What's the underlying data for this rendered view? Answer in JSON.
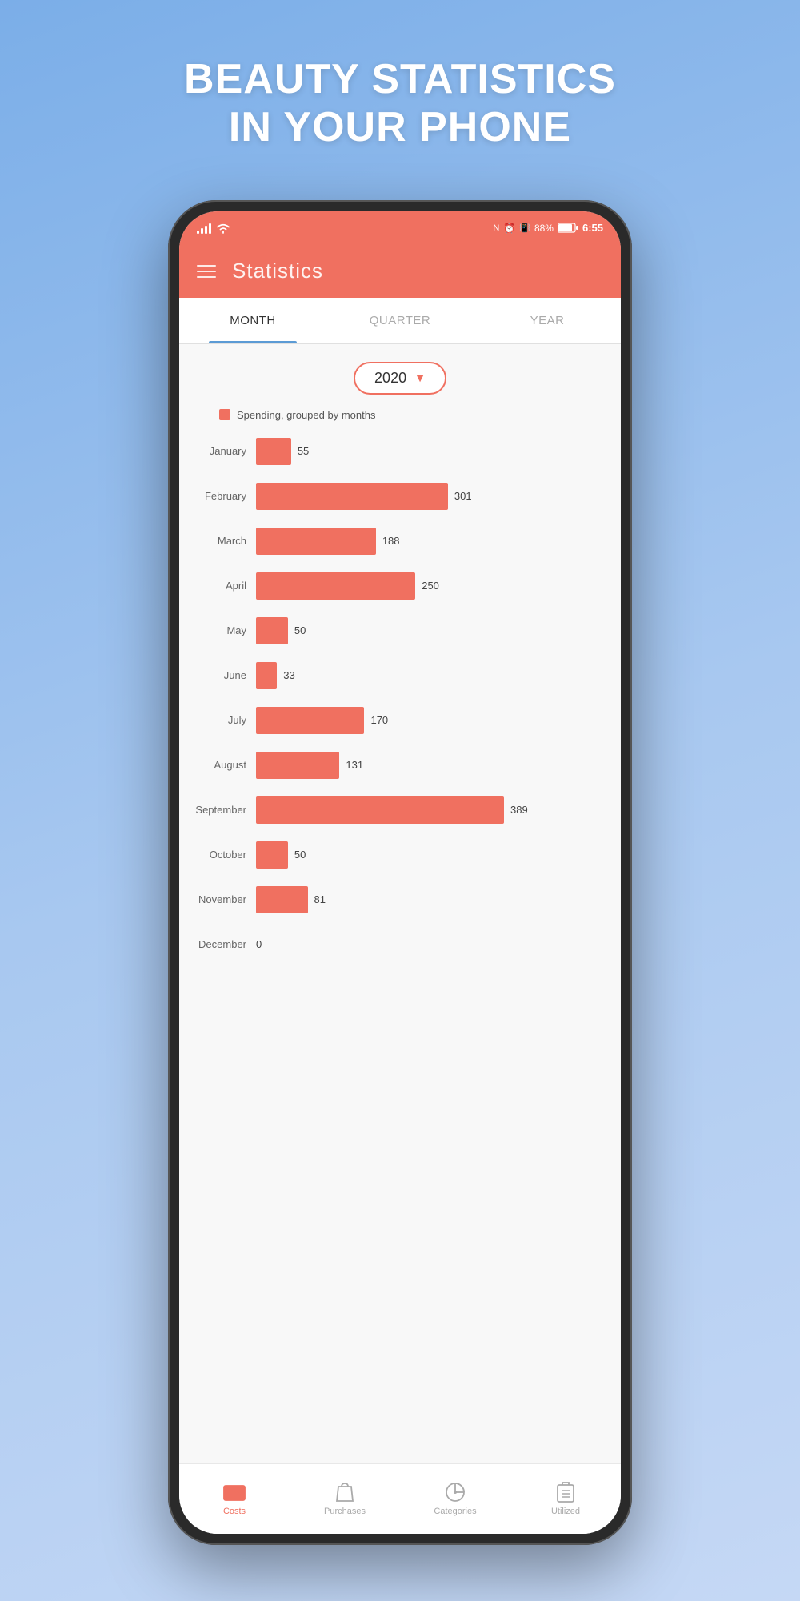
{
  "hero": {
    "line1": "BEAUTY STATISTICS",
    "line2": "IN YOUR PHONE"
  },
  "statusBar": {
    "battery": "88%",
    "time": "6:55"
  },
  "header": {
    "title": "Statistics"
  },
  "tabs": [
    {
      "label": "MONTH",
      "active": true
    },
    {
      "label": "QUARTER",
      "active": false
    },
    {
      "label": "YEAR",
      "active": false
    }
  ],
  "yearSelector": {
    "year": "2020"
  },
  "chart": {
    "legend": "Spending, grouped by months",
    "maxValue": 389,
    "rows": [
      {
        "month": "January",
        "value": 55
      },
      {
        "month": "February",
        "value": 301
      },
      {
        "month": "March",
        "value": 188
      },
      {
        "month": "April",
        "value": 250
      },
      {
        "month": "May",
        "value": 50
      },
      {
        "month": "June",
        "value": 33
      },
      {
        "month": "July",
        "value": 170
      },
      {
        "month": "August",
        "value": 131
      },
      {
        "month": "September",
        "value": 389
      },
      {
        "month": "October",
        "value": 50
      },
      {
        "month": "November",
        "value": 81
      },
      {
        "month": "December",
        "value": 0
      }
    ]
  },
  "bottomNav": [
    {
      "label": "Costs",
      "icon": "costs-icon",
      "active": true
    },
    {
      "label": "Purchases",
      "icon": "purchases-icon",
      "active": false
    },
    {
      "label": "Categories",
      "icon": "categories-icon",
      "active": false
    },
    {
      "label": "Utilized",
      "icon": "utilized-icon",
      "active": false
    }
  ]
}
